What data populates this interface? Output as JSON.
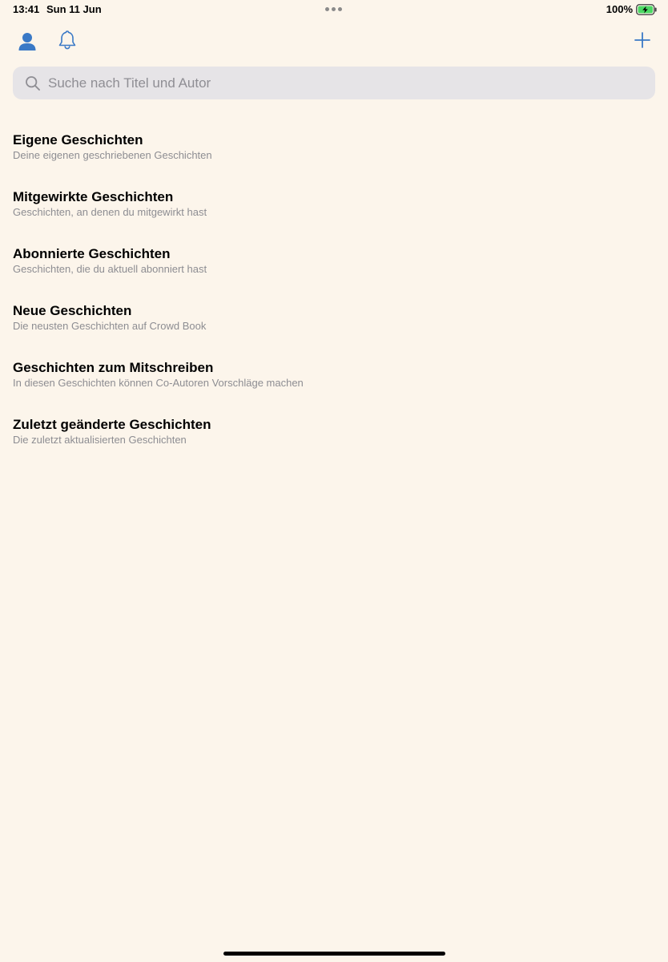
{
  "status_bar": {
    "time": "13:41",
    "date": "Sun 11 Jun",
    "battery_percent": "100%",
    "battery_color": "#4cd964"
  },
  "toolbar": {
    "profile_icon": "person-icon",
    "notifications_icon": "bell-icon",
    "add_icon": "plus-icon",
    "accent_color": "#3a79c6"
  },
  "search": {
    "placeholder": "Suche nach Titel und Autor",
    "value": ""
  },
  "categories": [
    {
      "title": "Eigene Geschichten",
      "subtitle": "Deine eigenen geschriebenen Geschichten"
    },
    {
      "title": "Mitgewirkte Geschichten",
      "subtitle": "Geschichten, an denen du mitgewirkt hast"
    },
    {
      "title": "Abonnierte Geschichten",
      "subtitle": "Geschichten, die du aktuell abonniert hast"
    },
    {
      "title": "Neue Geschichten",
      "subtitle": "Die neusten Geschichten auf Crowd Book"
    },
    {
      "title": "Geschichten zum Mitschreiben",
      "subtitle": "In diesen Geschichten können Co-Autoren Vorschläge machen"
    },
    {
      "title": "Zuletzt geänderte Geschichten",
      "subtitle": "Die zuletzt aktualisierten Geschichten"
    }
  ],
  "colors": {
    "background": "#fcf5eb",
    "search_background": "#e6e4e7",
    "subtitle_text": "#8d8d92"
  }
}
